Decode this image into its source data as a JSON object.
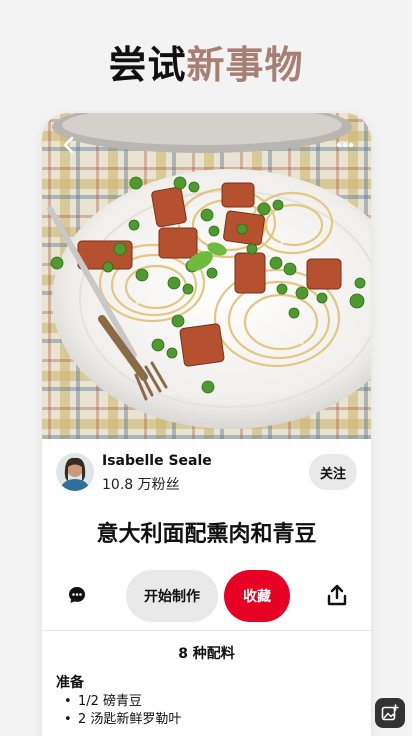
{
  "headline": {
    "part1": "尝试",
    "part2": "新事物"
  },
  "colors": {
    "accent": "#a77f73",
    "save": "#e60023",
    "pill": "#e9e9e9"
  },
  "hero": {
    "image": "pasta-with-bacon-and-peas-photo"
  },
  "author": {
    "name": "Isabelle Seale",
    "followers": "10.8 万粉丝",
    "follow_label": "关注"
  },
  "recipe_title": "意大利面配熏肉和青豆",
  "actions": {
    "start_label": "开始制作",
    "save_label": "收藏"
  },
  "ingredients": {
    "count_label": "8 种配料",
    "section_label": "准备",
    "items": [
      "1/2 磅青豆",
      "2 汤匙新鲜罗勒叶"
    ]
  },
  "icons": {
    "back": "chevron-left-icon",
    "more": "more-dots-icon",
    "comment": "comment-icon",
    "share": "share-icon",
    "fab": "add-image-icon"
  }
}
